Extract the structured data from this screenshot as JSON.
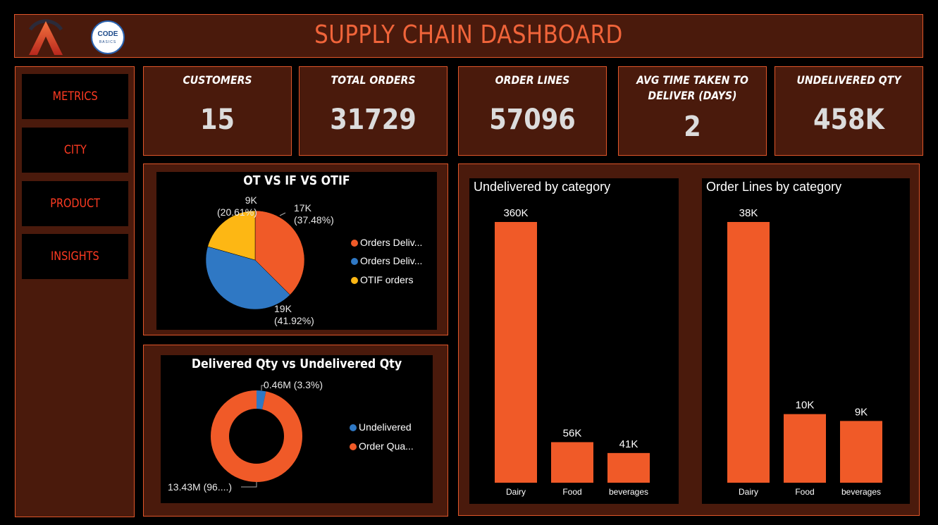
{
  "header": {
    "title": "SUPPLY CHAIN DASHBOARD",
    "logo_left": "atliq-a-logo",
    "logo_right_text": "CODE",
    "logo_right_sub": "BASICS"
  },
  "sidebar": {
    "items": [
      {
        "label": "METRICS"
      },
      {
        "label": "CITY"
      },
      {
        "label": "PRODUCT"
      },
      {
        "label": "INSIGHTS"
      }
    ]
  },
  "kpis": [
    {
      "label": "CUSTOMERS",
      "value": "15"
    },
    {
      "label": "TOTAL ORDERS",
      "value": "31729"
    },
    {
      "label": "ORDER LINES",
      "value": "57096"
    },
    {
      "label": "AVG TIME TAKEN TO DELIVER (DAYS)",
      "value": "2"
    },
    {
      "label": "UNDELIVERED QTY",
      "value": "458K"
    }
  ],
  "colors": {
    "accent": "#f05a28",
    "blue": "#2f78c4",
    "yellow": "#fdb714",
    "panel": "#4a1a0c",
    "border": "#e0562a"
  },
  "chart_data": [
    {
      "type": "pie",
      "title": "OT VS IF VS OTIF",
      "slices": [
        {
          "name": "Orders Deliv...",
          "value": 17,
          "pct": "37.48%",
          "label": "17K",
          "color": "#f05a28"
        },
        {
          "name": "Orders Deliv...",
          "value": 19,
          "pct": "41.92%",
          "label": "19K",
          "color": "#2f78c4"
        },
        {
          "name": "OTIF orders",
          "value": 9,
          "pct": "20.61%",
          "label": "9K",
          "color": "#fdb714"
        }
      ],
      "fractions": [
        0.3748,
        0.4192,
        0.2061
      ],
      "legend": "right"
    },
    {
      "type": "pie",
      "title": "Delivered Qty vs Undelivered Qty",
      "donut": true,
      "slices": [
        {
          "name": "Undelivered",
          "value": 0.46,
          "label": "0.46M (3.3%)",
          "color": "#2f78c4"
        },
        {
          "name": "Order Qua...",
          "value": 13.43,
          "label": "13.43M (96....)",
          "color": "#f05a28"
        }
      ],
      "legend": "right"
    },
    {
      "type": "bar",
      "title": "Undelivered by category",
      "categories": [
        "Dairy",
        "Food",
        "beverages"
      ],
      "values": [
        360,
        56,
        41
      ],
      "labels": [
        "360K",
        "56K",
        "41K"
      ],
      "unit": "K",
      "ylim": [
        0,
        360
      ]
    },
    {
      "type": "bar",
      "title": "Order Lines by category",
      "categories": [
        "Dairy",
        "Food",
        "beverages"
      ],
      "values": [
        38,
        10,
        9
      ],
      "labels": [
        "38K",
        "10K",
        "9K"
      ],
      "unit": "K",
      "ylim": [
        0,
        38
      ]
    }
  ]
}
